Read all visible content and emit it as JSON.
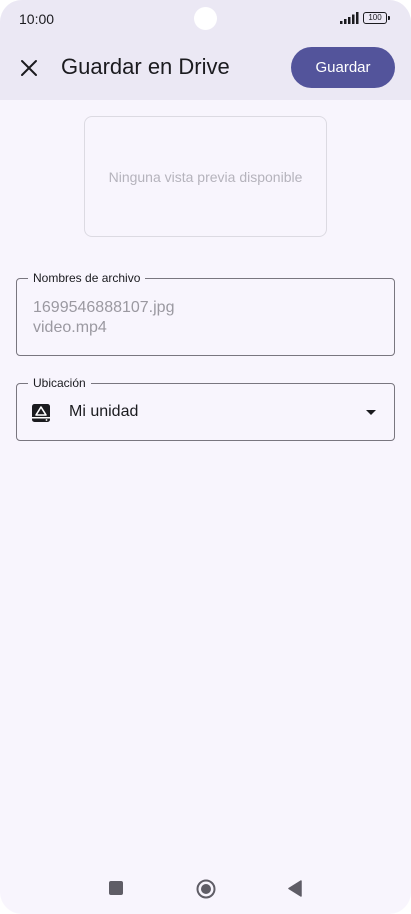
{
  "status_bar": {
    "time": "10:00",
    "battery": "100"
  },
  "header": {
    "title": "Guardar en Drive",
    "save_label": "Guardar"
  },
  "preview": {
    "text": "Ninguna vista previa disponible"
  },
  "file_names": {
    "label": "Nombres de archivo",
    "files": [
      "1699546888107.jpg",
      "video.mp4"
    ]
  },
  "location": {
    "label": "Ubicación",
    "value": "Mi unidad"
  },
  "colors": {
    "accent": "#53549b",
    "header_bg": "#ebe8f4",
    "page_bg": "#f8f5fd"
  },
  "icons": [
    "close-icon",
    "drive-icon",
    "dropdown-arrow-icon",
    "nav-recents-icon",
    "nav-home-icon",
    "nav-back-icon"
  ]
}
